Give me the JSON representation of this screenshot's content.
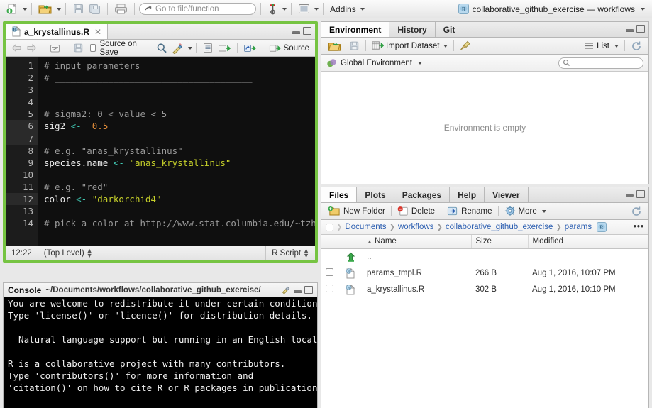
{
  "toolbar": {
    "new_file_icon": "new-file-icon",
    "open_file_icon": "open-folder-icon",
    "save_icon": "save-icon",
    "save_all_icon": "save-all-icon",
    "print_icon": "print-icon",
    "goto_placeholder": "Go to file/function",
    "goto_value": "",
    "addins_label": "Addins",
    "project_name": "collaborative_github_exercise — workflows"
  },
  "editor": {
    "tab_title": "a_krystallinus.R",
    "toolbar": {
      "back_icon": "back-arrow-icon",
      "forward_icon": "forward-arrow-icon",
      "popout_icon": "show-in-new-window-icon",
      "save_icon": "save-icon",
      "source_on_save_label": "Source on Save",
      "source_on_save_checked": false,
      "find_icon": "magnifier-icon",
      "magic_icon": "code-tools-icon",
      "compile_icon": "compile-report-icon",
      "run_icon": "run-icon",
      "rerun_icon": "re-run-icon",
      "source_label": "Source"
    },
    "lines": [
      {
        "n": 1,
        "active": false,
        "tokens": [
          {
            "t": "# input parameters",
            "c": "cmt"
          }
        ]
      },
      {
        "n": 2,
        "active": false,
        "tokens": [
          {
            "t": "# _____________________________________",
            "c": "cmt"
          }
        ]
      },
      {
        "n": 3,
        "active": false,
        "tokens": []
      },
      {
        "n": 4,
        "active": false,
        "tokens": []
      },
      {
        "n": 5,
        "active": false,
        "tokens": [
          {
            "t": "# sigma2: 0 < value < 5",
            "c": "cmt"
          }
        ]
      },
      {
        "n": 6,
        "active": true,
        "tokens": [
          {
            "t": "sig2 ",
            "c": "var"
          },
          {
            "t": "<-",
            "c": "op"
          },
          {
            "t": "  ",
            "c": "var"
          },
          {
            "t": "0.5",
            "c": "num"
          }
        ]
      },
      {
        "n": 7,
        "active": true,
        "tokens": []
      },
      {
        "n": 8,
        "active": false,
        "tokens": [
          {
            "t": "# e.g. \"anas_krystallinus\"",
            "c": "cmt"
          }
        ]
      },
      {
        "n": 9,
        "active": false,
        "tokens": [
          {
            "t": "species.name ",
            "c": "var"
          },
          {
            "t": "<-",
            "c": "op"
          },
          {
            "t": " ",
            "c": "var"
          },
          {
            "t": "\"anas_krystallinus\"",
            "c": "str"
          }
        ]
      },
      {
        "n": 10,
        "active": false,
        "tokens": []
      },
      {
        "n": 11,
        "active": false,
        "tokens": [
          {
            "t": "# e.g. \"red\"",
            "c": "cmt"
          }
        ]
      },
      {
        "n": 12,
        "active": true,
        "tokens": [
          {
            "t": "color ",
            "c": "var"
          },
          {
            "t": "<-",
            "c": "op"
          },
          {
            "t": " ",
            "c": "var"
          },
          {
            "t": "\"darkorchid4\"",
            "c": "str"
          }
        ]
      },
      {
        "n": 13,
        "active": false,
        "tokens": []
      },
      {
        "n": 14,
        "active": false,
        "tokens": [
          {
            "t": "# pick a color at http://www.stat.columbia.edu/~tzheng/f",
            "c": "cmt"
          }
        ]
      }
    ],
    "status": {
      "cursor": "12:22",
      "scope": "(Top Level)",
      "filetype": "R Script"
    }
  },
  "console": {
    "title": "Console",
    "path": "~/Documents/workflows/collaborative_github_exercise/",
    "output": "You are welcome to redistribute it under certain conditions.\nType 'license()' or 'licence()' for distribution details.\n\n  Natural language support but running in an English locale\n\nR is a collaborative project with many contributors.\nType 'contributors()' for more information and\n'citation()' on how to cite R or R packages in publications.\n\nType 'demo()' for some demos, 'help()' for on-line help, or"
  },
  "environment": {
    "tabs": [
      {
        "label": "Environment",
        "selected": true
      },
      {
        "label": "History",
        "selected": false
      },
      {
        "label": "Git",
        "selected": false
      }
    ],
    "toolbar": {
      "load_icon": "open-folder-icon",
      "save_icon": "save-icon",
      "import_label": "Import Dataset",
      "broom_icon": "clear-broom-icon",
      "list_label": "List",
      "refresh_icon": "refresh-icon"
    },
    "scope_label": "Global Environment",
    "search_placeholder": "",
    "search_value": "",
    "empty_message": "Environment is empty"
  },
  "files": {
    "tabs": [
      {
        "label": "Files",
        "selected": true
      },
      {
        "label": "Plots",
        "selected": false
      },
      {
        "label": "Packages",
        "selected": false
      },
      {
        "label": "Help",
        "selected": false
      },
      {
        "label": "Viewer",
        "selected": false
      }
    ],
    "toolbar": {
      "new_folder_label": "New Folder",
      "delete_label": "Delete",
      "rename_label": "Rename",
      "more_label": "More",
      "refresh_icon": "refresh-icon"
    },
    "breadcrumb": [
      "Documents",
      "workflows",
      "collaborative_github_exercise",
      "params"
    ],
    "breadcrumb_project_icon": "r-project-icon",
    "breadcrumb_more": "•••",
    "columns": [
      "Name",
      "Size",
      "Modified"
    ],
    "sort_indicator": "▲",
    "rows": [
      {
        "icon": "up-folder-icon",
        "name": "..",
        "size": "",
        "modified": "",
        "checkbox": false
      },
      {
        "icon": "r-file-icon",
        "name": "params_tmpl.R",
        "size": "266 B",
        "modified": "Aug 1, 2016, 10:07 PM",
        "checkbox": true
      },
      {
        "icon": "r-file-icon",
        "name": "a_krystallinus.R",
        "size": "302 B",
        "modified": "Aug 1, 2016, 10:10 PM",
        "checkbox": true
      }
    ]
  },
  "colors": {
    "focus_border": "#76c442",
    "editor_bg": "#0f0f0f",
    "console_bg": "#000000",
    "link": "#2a5db0",
    "comment": "#9a9a9a",
    "string": "#c6d02a",
    "operator": "#41c9b4",
    "number": "#e08c3a"
  }
}
